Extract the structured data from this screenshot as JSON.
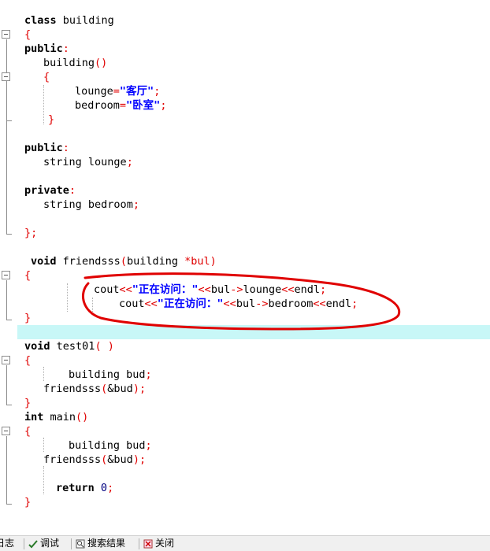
{
  "code": {
    "l1": "building",
    "l3_open": "{",
    "public_kw": "public",
    "ctor_name": "building",
    "lounge": "lounge",
    "lounge_val": "\"客厅\"",
    "bedroom": "bedroom",
    "bedroom_val": "\"卧室\"",
    "string_t": "string",
    "lounge_decl": "lounge",
    "private_kw": "private",
    "bedroom_decl": "bedroom",
    "class_kw": "class",
    "void_kw": "void",
    "friend_fn": "friendsss",
    "friend_params": "building ",
    "friend_ptr": "*bul",
    "cout": "cout",
    "visit_str": "\"正在访问：\"",
    "bul": "bul",
    "arrow": "->",
    "endl": "endl",
    "test_fn": "test01",
    "bud_decl": "building bud",
    "call": "friendsss",
    "bud_ref": "&bud",
    "int_kw": "int",
    "main_fn": "main",
    "return_kw": "return",
    "zero": "0"
  },
  "status": {
    "tab1": "日志",
    "tab2": "调试",
    "tab3": "搜索结果",
    "tab4": "关闭"
  },
  "colors": {
    "annotation": "#e00000",
    "current_line": "#c8f7f7"
  }
}
